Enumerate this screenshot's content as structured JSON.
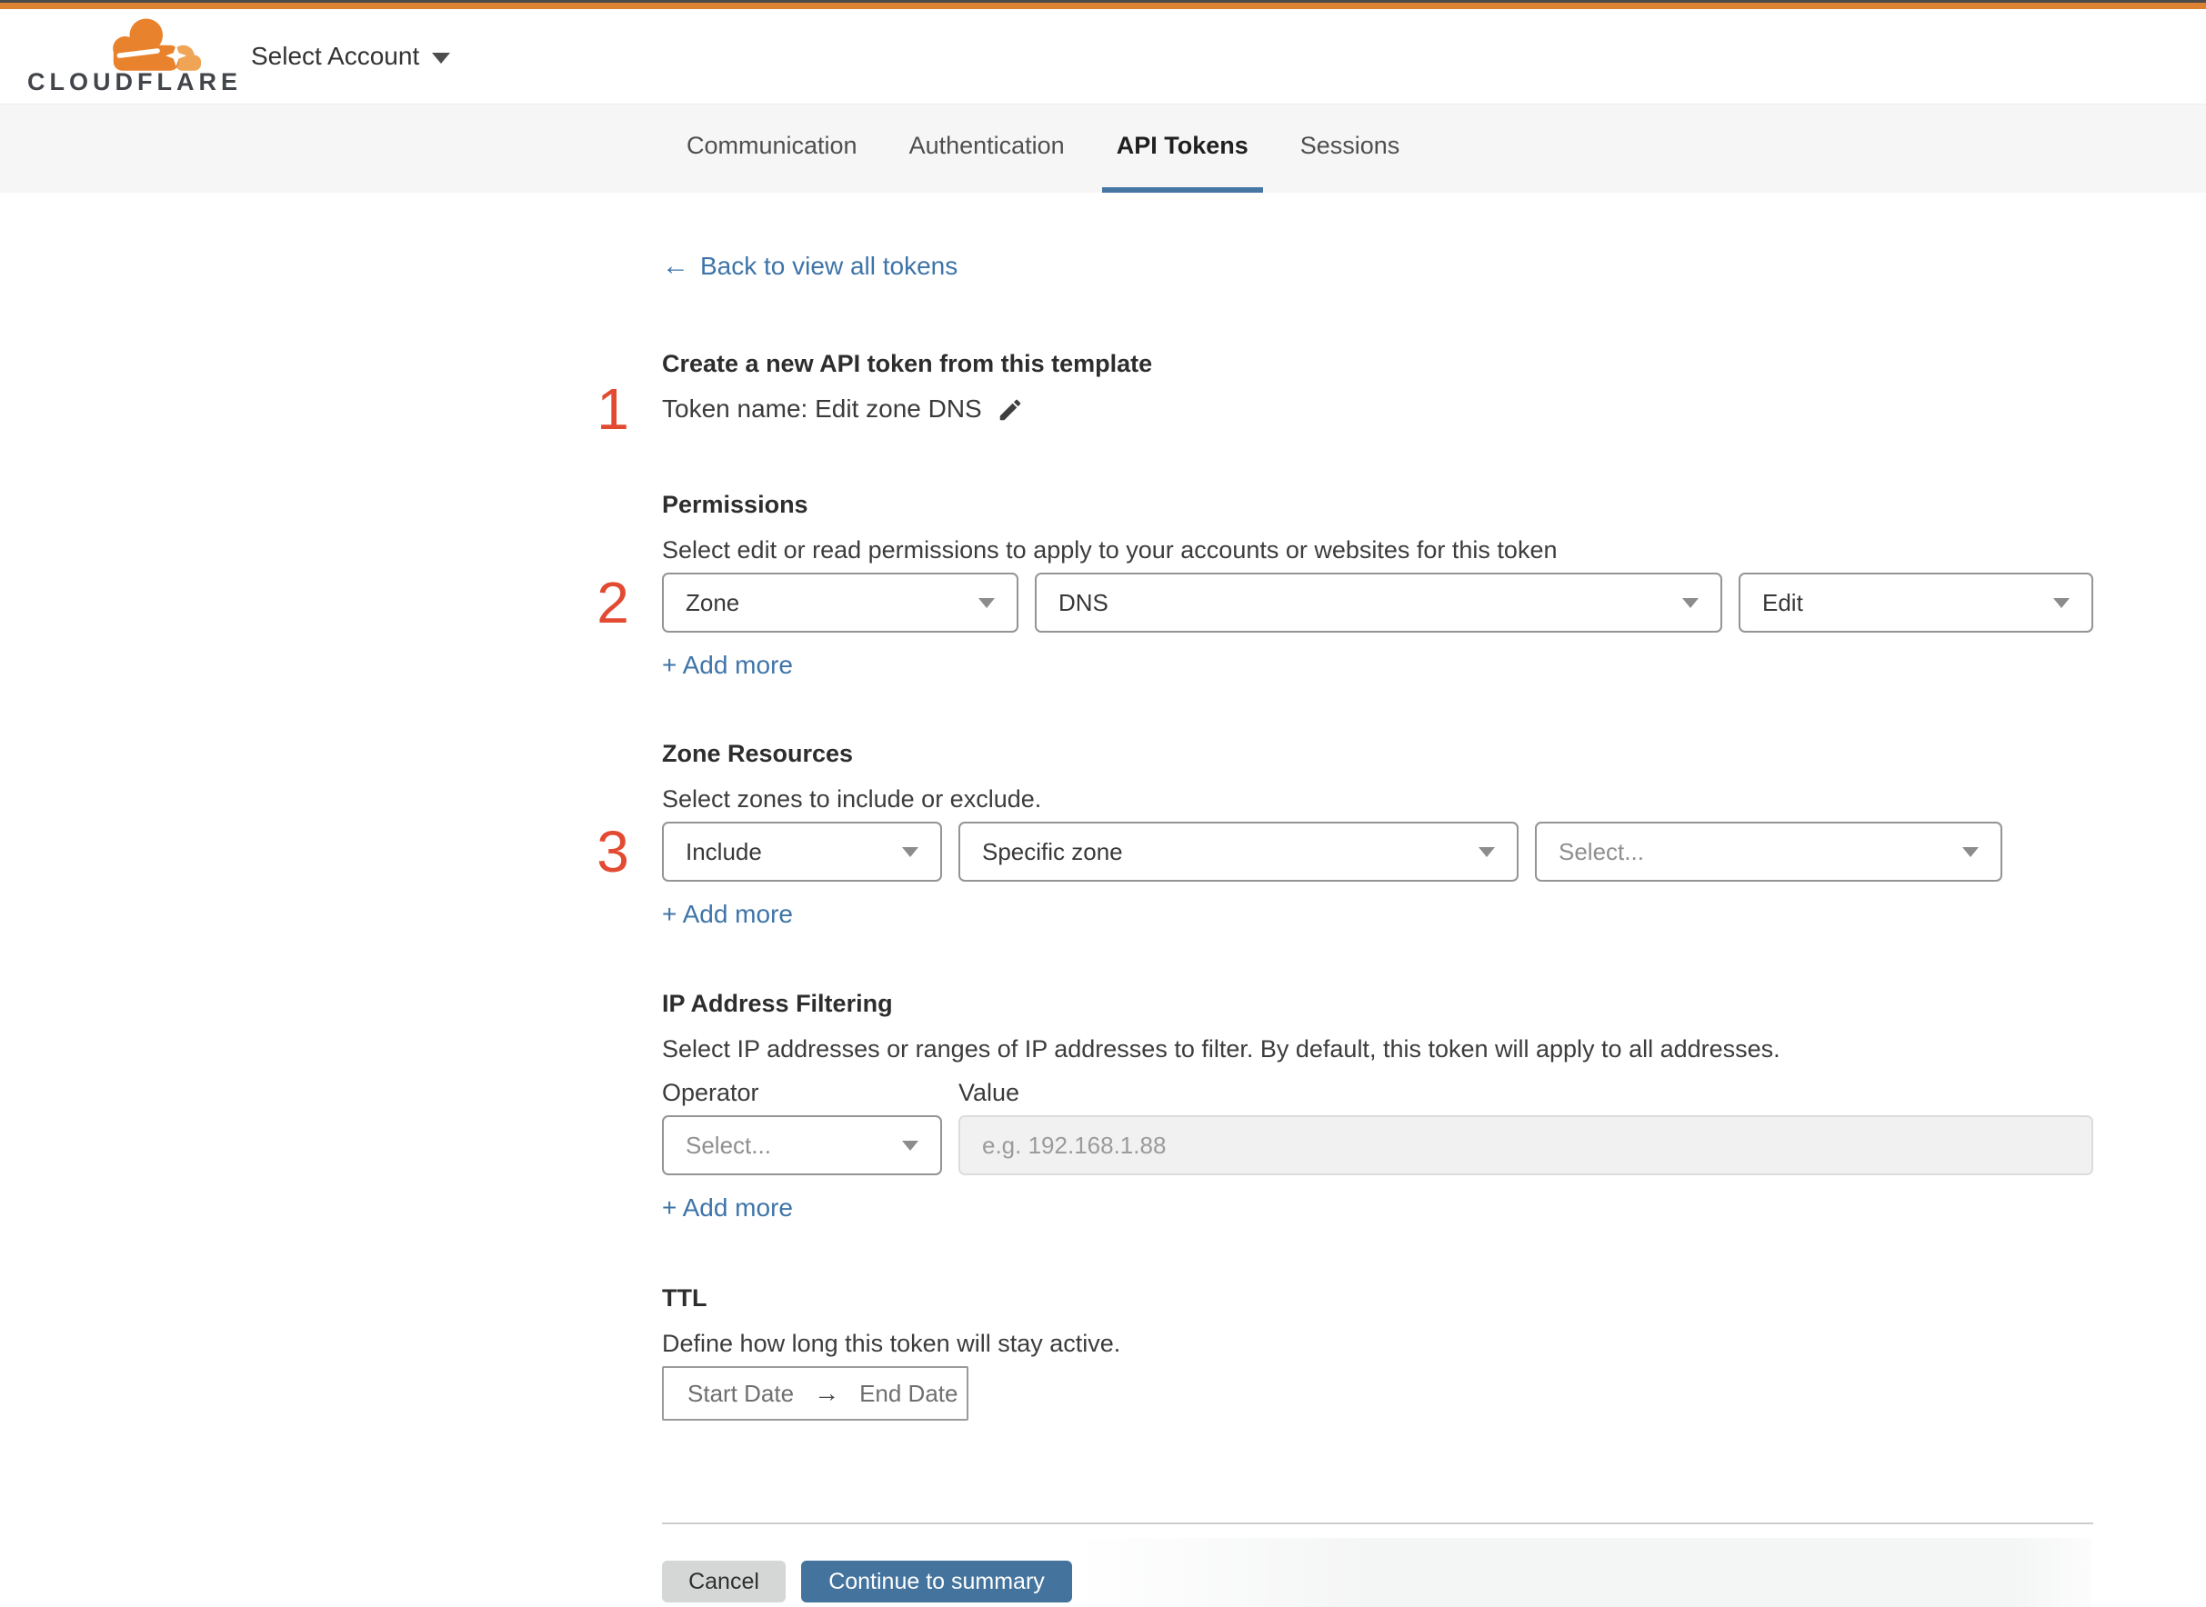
{
  "header": {
    "brand": "CLOUDFLARE",
    "select_account": "Select Account"
  },
  "tabs": {
    "items": [
      {
        "label": "Communication"
      },
      {
        "label": "Authentication"
      },
      {
        "label": "API Tokens"
      },
      {
        "label": "Sessions"
      }
    ],
    "active_label": "API Tokens"
  },
  "back": {
    "arrow": "←",
    "label": "Back to view all tokens"
  },
  "token_section": {
    "step": "1",
    "title": "Create a new API token from this template",
    "token_name_line": "Token name: Edit zone DNS"
  },
  "permissions": {
    "step": "2",
    "title": "Permissions",
    "description": "Select edit or read permissions to apply to your accounts or websites for this token",
    "scope_value": "Zone",
    "resource_value": "DNS",
    "access_value": "Edit",
    "add_more": "+ Add more"
  },
  "zone_resources": {
    "step": "3",
    "title": "Zone Resources",
    "description": "Select zones to include or exclude.",
    "mode_value": "Include",
    "type_value": "Specific zone",
    "zone_placeholder": "Select...",
    "add_more": "+ Add more"
  },
  "ip_filtering": {
    "title": "IP Address Filtering",
    "description": "Select IP addresses or ranges of IP addresses to filter. By default, this token will apply to all addresses.",
    "operator_label": "Operator",
    "value_label": "Value",
    "operator_placeholder": "Select...",
    "value_placeholder": "e.g. 192.168.1.88",
    "add_more": "+ Add more"
  },
  "ttl": {
    "title": "TTL",
    "description": "Define how long this token will stay active.",
    "start_label": "Start Date",
    "arrow": "→",
    "end_label": "End Date"
  },
  "footer": {
    "cancel": "Cancel",
    "continue": "Continue to summary"
  },
  "colors": {
    "accent_blue": "#3e74a8",
    "tab_underline_blue": "#4677a4",
    "button_blue": "#44749e",
    "step_red": "#e24a31",
    "brand_orange": "#dd8230",
    "topbar_dark": "#4a4a4a"
  }
}
